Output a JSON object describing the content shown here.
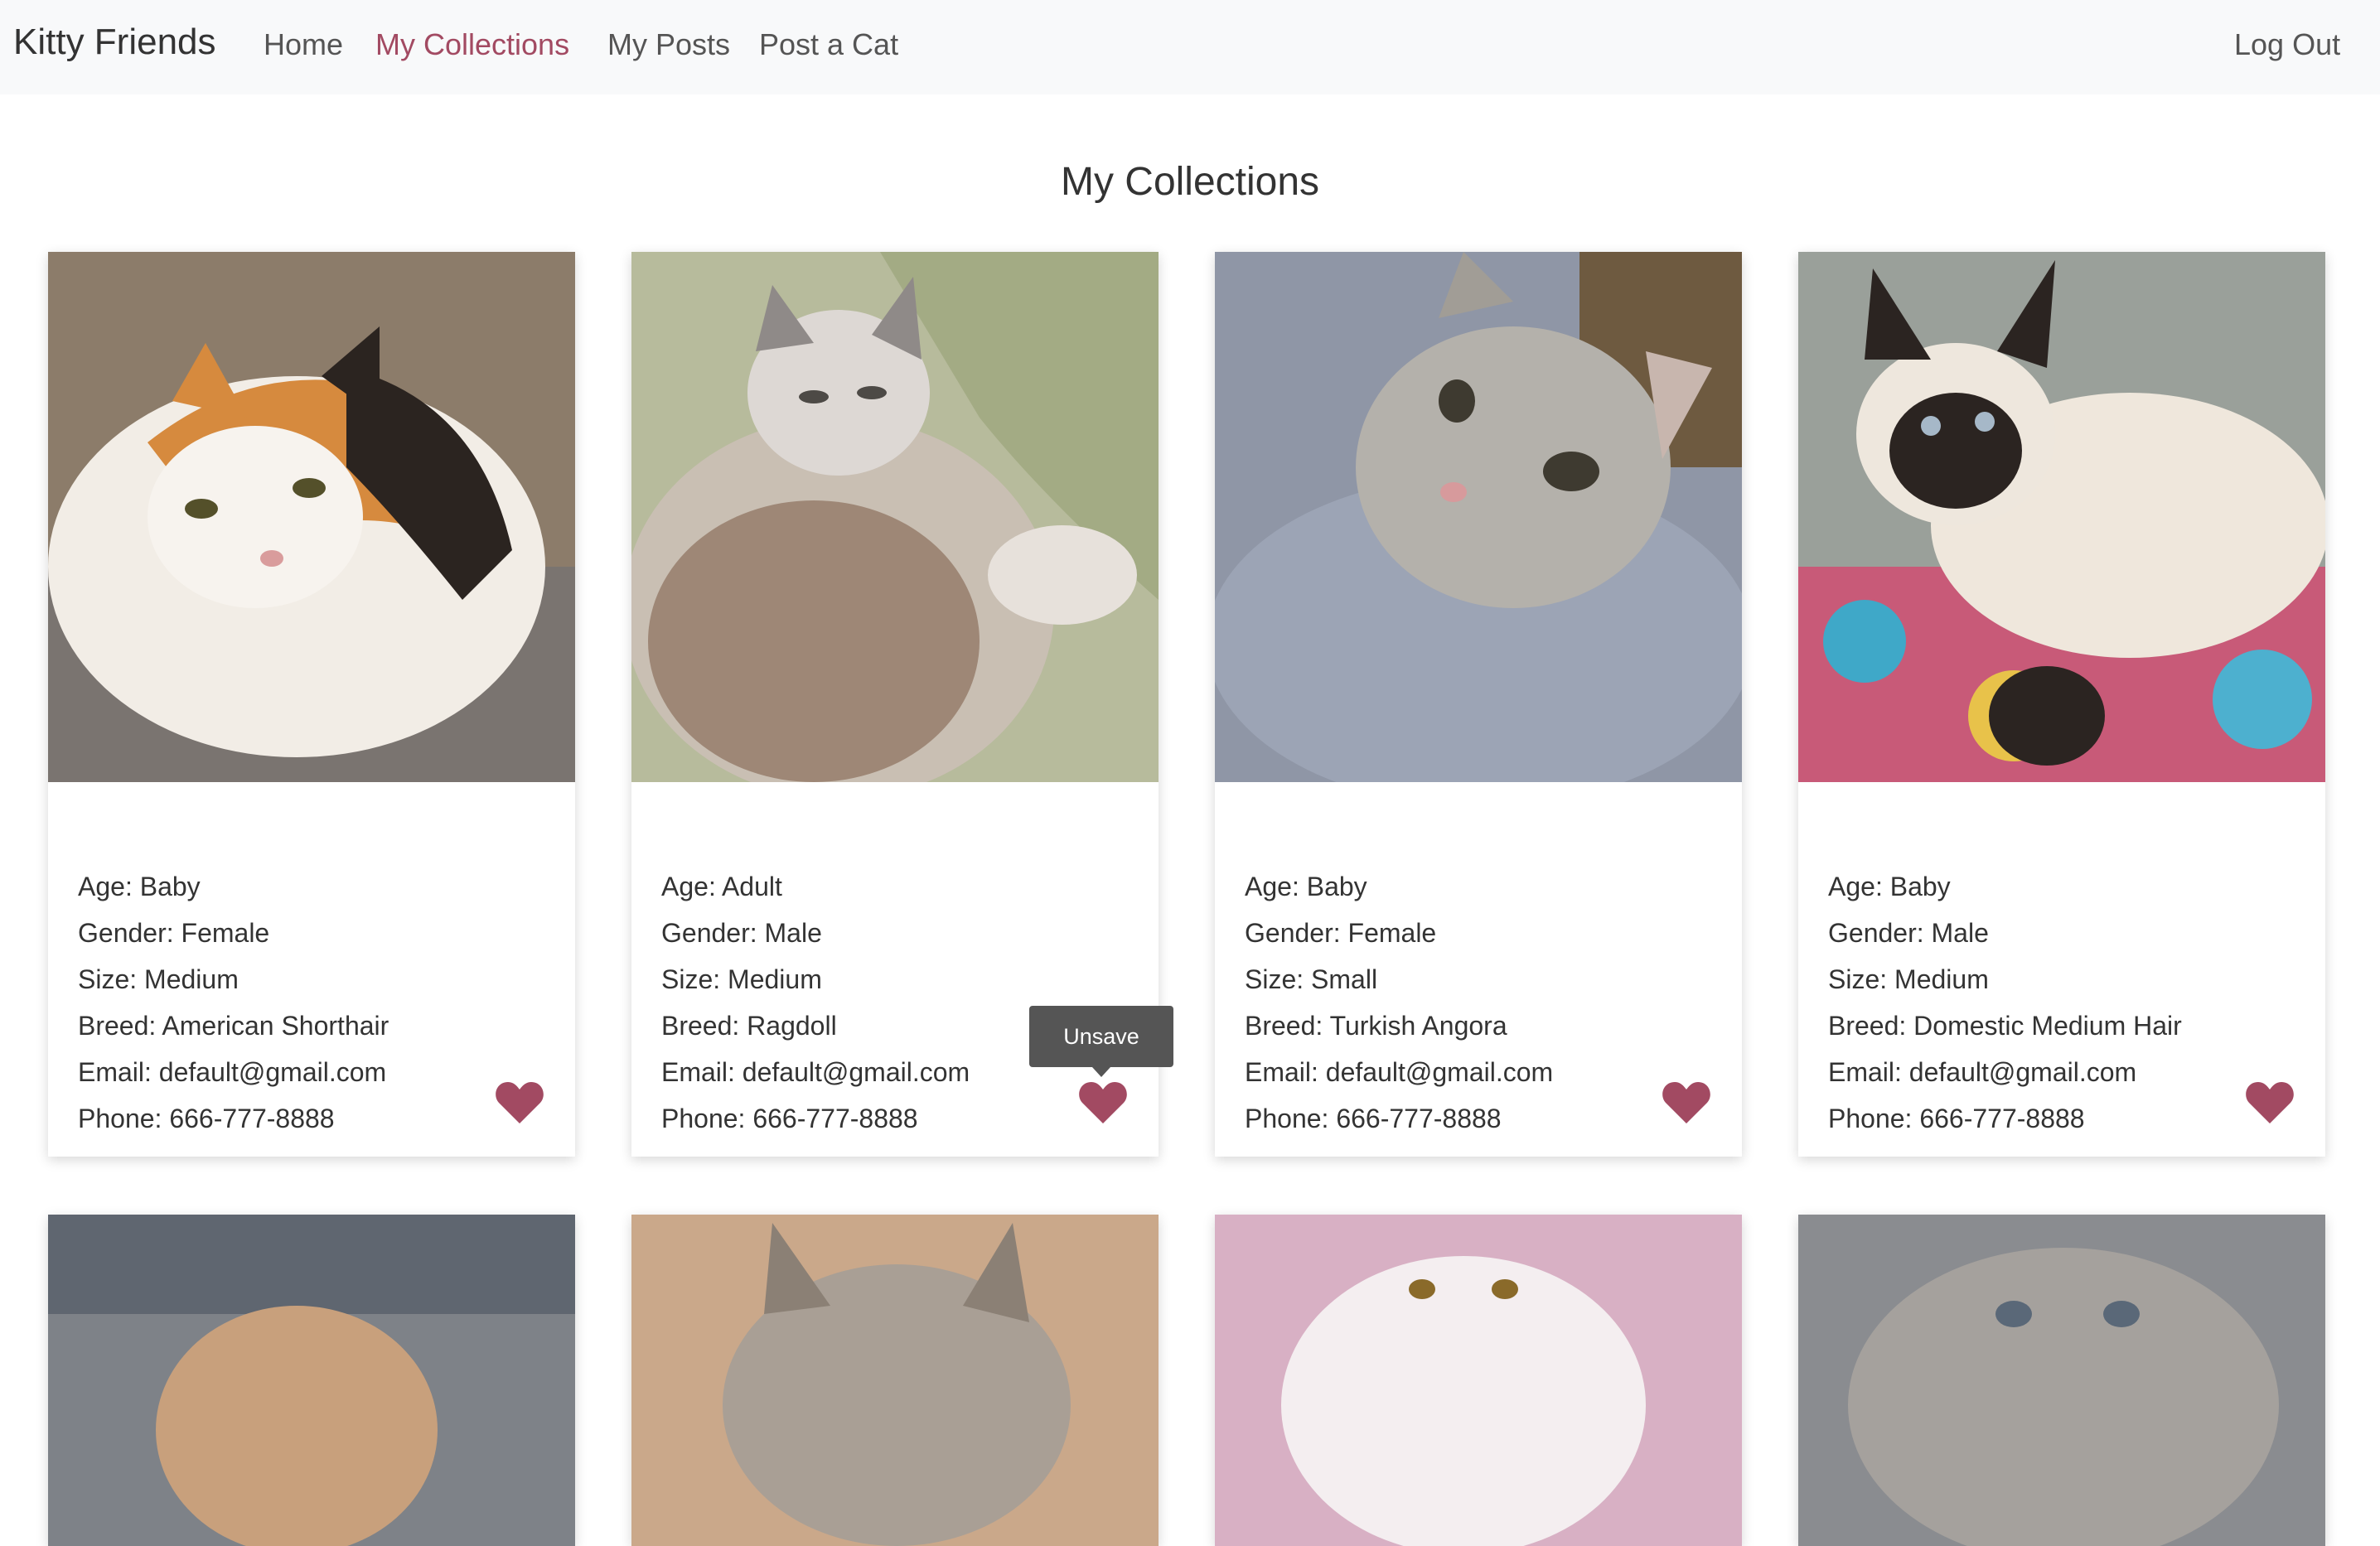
{
  "nav": {
    "brand": "Kitty Friends",
    "links": [
      "Home",
      "My Collections",
      "My Posts",
      "Post a Cat"
    ],
    "active": "My Collections",
    "logout": "Log Out"
  },
  "page": {
    "title": "My Collections"
  },
  "tooltip": "Unsave",
  "colors": {
    "accent": "#a24a62",
    "heart": "#a24a62",
    "nav_bg": "#f8f9fa"
  },
  "cards": [
    {
      "age": "Age: Baby",
      "gender": "Gender: Female",
      "size": "Size: Medium",
      "breed": "Breed: American Shorthair",
      "email": "Email: default@gmail.com",
      "phone": "Phone: 666-777-8888"
    },
    {
      "age": "Age: Adult",
      "gender": "Gender: Male",
      "size": "Size: Medium",
      "breed": "Breed: Ragdoll",
      "email": "Email: default@gmail.com",
      "phone": "Phone: 666-777-8888"
    },
    {
      "age": "Age: Baby",
      "gender": "Gender: Female",
      "size": "Size: Small",
      "breed": "Breed: Turkish Angora",
      "email": "Email: default@gmail.com",
      "phone": "Phone: 666-777-8888"
    },
    {
      "age": "Age: Baby",
      "gender": "Gender: Male",
      "size": "Size: Medium",
      "breed": "Breed: Domestic Medium Hair",
      "email": "Email: default@gmail.com",
      "phone": "Phone: 666-777-8888"
    }
  ]
}
